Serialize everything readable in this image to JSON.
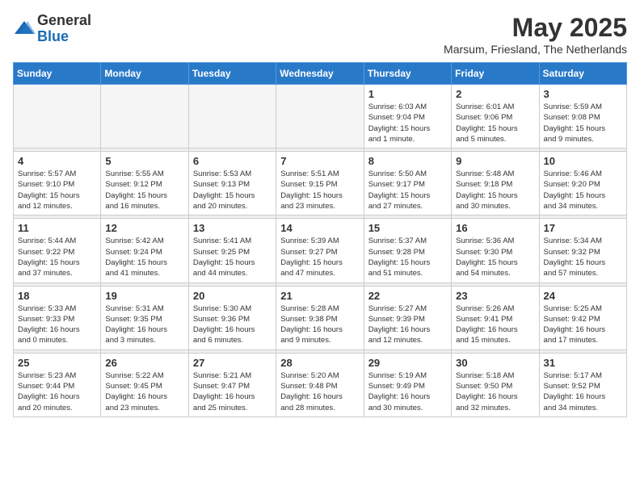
{
  "logo": {
    "general": "General",
    "blue": "Blue"
  },
  "title": "May 2025",
  "location": "Marsum, Friesland, The Netherlands",
  "weekdays": [
    "Sunday",
    "Monday",
    "Tuesday",
    "Wednesday",
    "Thursday",
    "Friday",
    "Saturday"
  ],
  "weeks": [
    [
      {
        "day": "",
        "info": ""
      },
      {
        "day": "",
        "info": ""
      },
      {
        "day": "",
        "info": ""
      },
      {
        "day": "",
        "info": ""
      },
      {
        "day": "1",
        "info": "Sunrise: 6:03 AM\nSunset: 9:04 PM\nDaylight: 15 hours\nand 1 minute."
      },
      {
        "day": "2",
        "info": "Sunrise: 6:01 AM\nSunset: 9:06 PM\nDaylight: 15 hours\nand 5 minutes."
      },
      {
        "day": "3",
        "info": "Sunrise: 5:59 AM\nSunset: 9:08 PM\nDaylight: 15 hours\nand 9 minutes."
      }
    ],
    [
      {
        "day": "4",
        "info": "Sunrise: 5:57 AM\nSunset: 9:10 PM\nDaylight: 15 hours\nand 12 minutes."
      },
      {
        "day": "5",
        "info": "Sunrise: 5:55 AM\nSunset: 9:12 PM\nDaylight: 15 hours\nand 16 minutes."
      },
      {
        "day": "6",
        "info": "Sunrise: 5:53 AM\nSunset: 9:13 PM\nDaylight: 15 hours\nand 20 minutes."
      },
      {
        "day": "7",
        "info": "Sunrise: 5:51 AM\nSunset: 9:15 PM\nDaylight: 15 hours\nand 23 minutes."
      },
      {
        "day": "8",
        "info": "Sunrise: 5:50 AM\nSunset: 9:17 PM\nDaylight: 15 hours\nand 27 minutes."
      },
      {
        "day": "9",
        "info": "Sunrise: 5:48 AM\nSunset: 9:18 PM\nDaylight: 15 hours\nand 30 minutes."
      },
      {
        "day": "10",
        "info": "Sunrise: 5:46 AM\nSunset: 9:20 PM\nDaylight: 15 hours\nand 34 minutes."
      }
    ],
    [
      {
        "day": "11",
        "info": "Sunrise: 5:44 AM\nSunset: 9:22 PM\nDaylight: 15 hours\nand 37 minutes."
      },
      {
        "day": "12",
        "info": "Sunrise: 5:42 AM\nSunset: 9:24 PM\nDaylight: 15 hours\nand 41 minutes."
      },
      {
        "day": "13",
        "info": "Sunrise: 5:41 AM\nSunset: 9:25 PM\nDaylight: 15 hours\nand 44 minutes."
      },
      {
        "day": "14",
        "info": "Sunrise: 5:39 AM\nSunset: 9:27 PM\nDaylight: 15 hours\nand 47 minutes."
      },
      {
        "day": "15",
        "info": "Sunrise: 5:37 AM\nSunset: 9:28 PM\nDaylight: 15 hours\nand 51 minutes."
      },
      {
        "day": "16",
        "info": "Sunrise: 5:36 AM\nSunset: 9:30 PM\nDaylight: 15 hours\nand 54 minutes."
      },
      {
        "day": "17",
        "info": "Sunrise: 5:34 AM\nSunset: 9:32 PM\nDaylight: 15 hours\nand 57 minutes."
      }
    ],
    [
      {
        "day": "18",
        "info": "Sunrise: 5:33 AM\nSunset: 9:33 PM\nDaylight: 16 hours\nand 0 minutes."
      },
      {
        "day": "19",
        "info": "Sunrise: 5:31 AM\nSunset: 9:35 PM\nDaylight: 16 hours\nand 3 minutes."
      },
      {
        "day": "20",
        "info": "Sunrise: 5:30 AM\nSunset: 9:36 PM\nDaylight: 16 hours\nand 6 minutes."
      },
      {
        "day": "21",
        "info": "Sunrise: 5:28 AM\nSunset: 9:38 PM\nDaylight: 16 hours\nand 9 minutes."
      },
      {
        "day": "22",
        "info": "Sunrise: 5:27 AM\nSunset: 9:39 PM\nDaylight: 16 hours\nand 12 minutes."
      },
      {
        "day": "23",
        "info": "Sunrise: 5:26 AM\nSunset: 9:41 PM\nDaylight: 16 hours\nand 15 minutes."
      },
      {
        "day": "24",
        "info": "Sunrise: 5:25 AM\nSunset: 9:42 PM\nDaylight: 16 hours\nand 17 minutes."
      }
    ],
    [
      {
        "day": "25",
        "info": "Sunrise: 5:23 AM\nSunset: 9:44 PM\nDaylight: 16 hours\nand 20 minutes."
      },
      {
        "day": "26",
        "info": "Sunrise: 5:22 AM\nSunset: 9:45 PM\nDaylight: 16 hours\nand 23 minutes."
      },
      {
        "day": "27",
        "info": "Sunrise: 5:21 AM\nSunset: 9:47 PM\nDaylight: 16 hours\nand 25 minutes."
      },
      {
        "day": "28",
        "info": "Sunrise: 5:20 AM\nSunset: 9:48 PM\nDaylight: 16 hours\nand 28 minutes."
      },
      {
        "day": "29",
        "info": "Sunrise: 5:19 AM\nSunset: 9:49 PM\nDaylight: 16 hours\nand 30 minutes."
      },
      {
        "day": "30",
        "info": "Sunrise: 5:18 AM\nSunset: 9:50 PM\nDaylight: 16 hours\nand 32 minutes."
      },
      {
        "day": "31",
        "info": "Sunrise: 5:17 AM\nSunset: 9:52 PM\nDaylight: 16 hours\nand 34 minutes."
      }
    ]
  ]
}
